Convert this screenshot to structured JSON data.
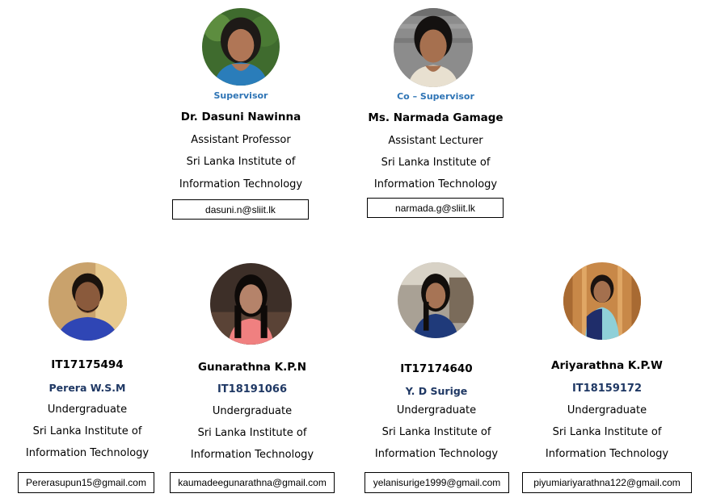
{
  "supervisors": [
    {
      "role": "Supervisor",
      "name": "Dr. Dasuni Nawinna",
      "title": "Assistant Professor",
      "org_line1": "Sri Lanka Institute of",
      "org_line2": "Information Technology",
      "email": "dasuni.n@sliit.lk",
      "photo_bg": "#3f6b2e"
    },
    {
      "role": "Co – Supervisor",
      "name": "Ms. Narmada Gamage",
      "title": "Assistant Lecturer",
      "org_line1": "Sri Lanka Institute of",
      "org_line2": "Information Technology",
      "email": "narmada.g@sliit.lk",
      "photo_bg": "#8c8c8c"
    }
  ],
  "students": [
    {
      "line_a": "IT17175494",
      "line_b": "Perera W.S.M",
      "status": "Undergraduate",
      "org_line1": "Sri Lanka Institute of",
      "org_line2": "Information Technology",
      "email": "Pererasupun15@gmail.com"
    },
    {
      "line_a": "Gunarathna  K.P.N",
      "line_b": "IT18191066",
      "status": "Undergraduate",
      "org_line1": "Sri Lanka Institute of",
      "org_line2": "Information Technology",
      "email": "kaumadeegunarathna@gmail.com"
    },
    {
      "line_a": "IT17174640",
      "line_b": "Y. D Surige",
      "status": "Undergraduate",
      "org_line1": "Sri Lanka Institute of",
      "org_line2": "Information Technology",
      "email": "yelanisurige1999@gmail.com"
    },
    {
      "line_a": "Ariyarathna K.P.W",
      "line_b": "IT18159172",
      "status": "Undergraduate",
      "org_line1": "Sri Lanka Institute of",
      "org_line2": "Information Technology",
      "email": "piyumiariyarathna122@gmail.com"
    }
  ]
}
